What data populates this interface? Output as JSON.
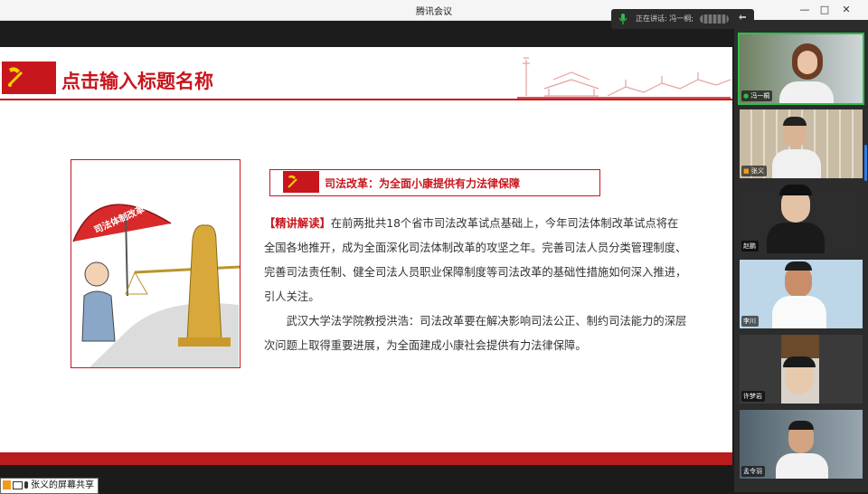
{
  "window": {
    "title": "腾讯会议",
    "controls": [
      "minimize",
      "maximize",
      "close"
    ]
  },
  "speaking": {
    "text": "正在讲话: 冯一桐;"
  },
  "slide": {
    "title": "点击输入标题名称",
    "subtitle": "司法改革：为全面小康提供有力法律保障",
    "highlight": "【精讲解读】",
    "paragraph1": "在前两批共18个省市司法改革试点基础上，今年司法体制改革试点将在全国各地推开，成为全面深化司法体制改革的攻坚之年。完善司法人员分类管理制度、完善司法责任制、健全司法人员职业保障制度等司法改革的基础性措施如何深入推进，引人关注。",
    "paragraph2": "武汉大学法学院教授洪浩：司法改革要在解决影响司法公正、制约司法能力的深层次问题上取得重要进展，为全面建成小康社会提供有力法律保障。",
    "illustration_umbrella_text": "司法体制改革",
    "colors": {
      "accent": "#c8161d"
    }
  },
  "share_label": "张义的屏幕共享",
  "participants": [
    {
      "name": "冯一桐",
      "speaking": true
    },
    {
      "name": "张义"
    },
    {
      "name": "赵鹏"
    },
    {
      "name": "李川"
    },
    {
      "name": "许梦岩"
    },
    {
      "name": "孟令羽"
    }
  ]
}
